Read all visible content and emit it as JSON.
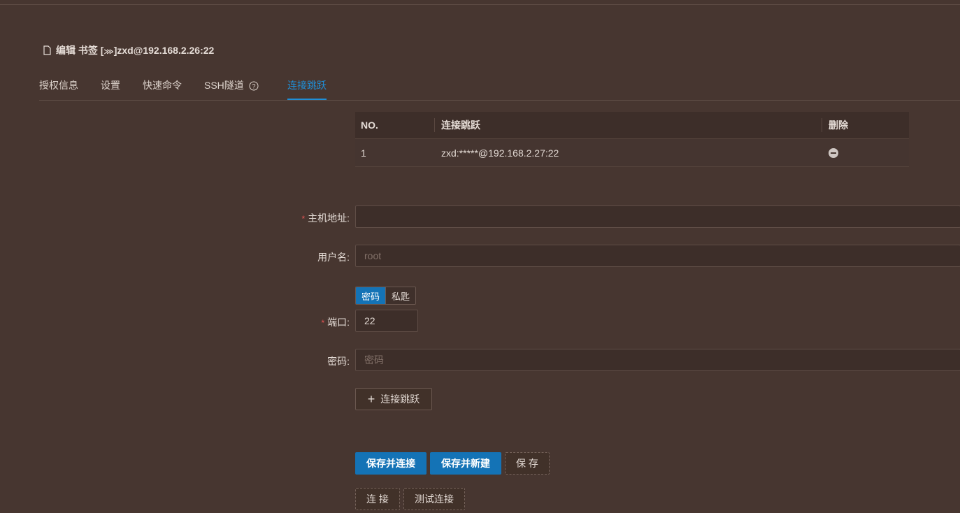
{
  "header": {
    "title_prefix": "编辑 书签 [",
    "title_glyph": "⋙",
    "title_suffix": "]zxd@192.168.2.26:22"
  },
  "tabs": [
    {
      "label": "授权信息",
      "active": false
    },
    {
      "label": "设置",
      "active": false
    },
    {
      "label": "快速命令",
      "active": false
    },
    {
      "label": "SSH隧道",
      "active": false
    },
    {
      "label": "连接跳跃",
      "active": true
    }
  ],
  "table": {
    "columns": [
      "NO.",
      "连接跳跃",
      "删除"
    ],
    "rows": [
      {
        "no": "1",
        "jump": "zxd:*****@192.168.2.27:22"
      }
    ]
  },
  "form": {
    "host_label": "主机地址:",
    "host_value": "",
    "username_label": "用户名:",
    "username_placeholder": "root",
    "auth_options": [
      "密码",
      "私匙"
    ],
    "auth_selected": "密码",
    "port_label": "端口:",
    "port_value": "22",
    "password_label": "密码:",
    "password_placeholder": "密码",
    "add_jump_label": "连接跳跃"
  },
  "actions": {
    "save_connect": "保存并连接",
    "save_new": "保存并新建",
    "save": "保 存",
    "connect": "连 接",
    "test_connect": "测试连接"
  },
  "colors": {
    "background": "#473630",
    "accent": "#1473b6",
    "active_tab": "#1f8fd8",
    "required": "#e55454"
  }
}
